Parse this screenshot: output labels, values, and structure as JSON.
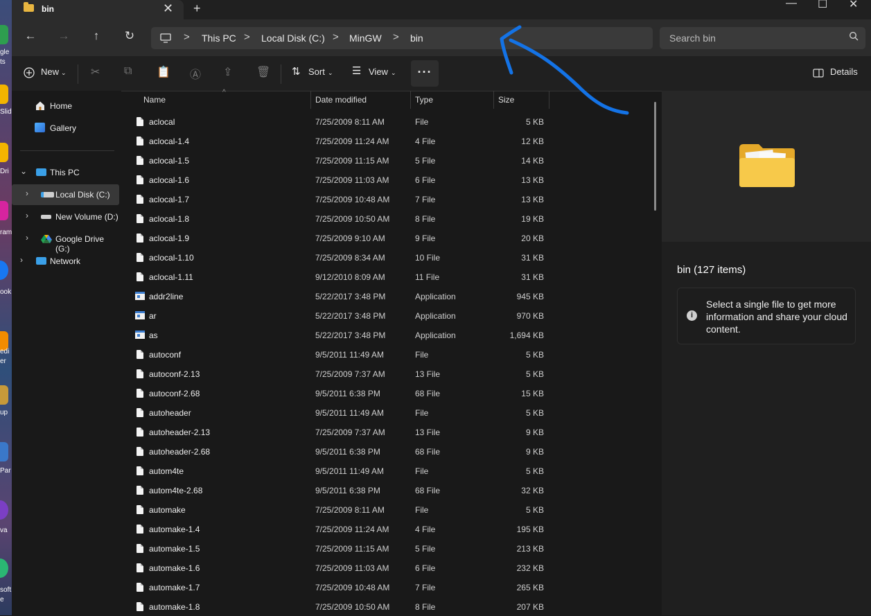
{
  "desktop": {
    "labels": [
      "gle",
      "ts",
      "Slid",
      "Dri",
      "ram",
      "ook",
      "edi",
      "er",
      "up",
      "Par",
      "va",
      "soft",
      "e"
    ]
  },
  "window": {
    "tab_title": "bin",
    "tab_close": "✕",
    "new_tab": "+",
    "minimize": "—",
    "maximize": "☐",
    "close": "✕"
  },
  "nav_buttons": {
    "back": "←",
    "forward": "→",
    "up": "↑",
    "refresh": "↻"
  },
  "breadcrumb": {
    "computer_icon": "monitor-icon",
    "items": [
      "This PC",
      "Local Disk (C:)",
      "MinGW",
      "bin"
    ],
    "separator": ">"
  },
  "search": {
    "placeholder": "Search bin",
    "icon": "search-icon"
  },
  "toolbar": {
    "new_label": "New",
    "sort_label": "Sort",
    "view_label": "View",
    "more_label": "···",
    "details_label": "Details",
    "icons": [
      "cut-icon",
      "copy-icon",
      "paste-icon",
      "rename-icon",
      "share-icon",
      "delete-icon"
    ]
  },
  "sidebar": {
    "home": "Home",
    "gallery": "Gallery",
    "this_pc": "This PC",
    "local_disk": "Local Disk (C:)",
    "new_volume": "New Volume (D:)",
    "google_drive": "Google Drive (G:)",
    "network": "Network"
  },
  "columns": {
    "name": "Name",
    "date": "Date modified",
    "type": "Type",
    "size": "Size"
  },
  "files": [
    {
      "name": "aclocal",
      "date": "7/25/2009 8:11 AM",
      "type": "File",
      "size": "5 KB",
      "kind": "file"
    },
    {
      "name": "aclocal-1.4",
      "date": "7/25/2009 11:24 AM",
      "type": "4 File",
      "size": "12 KB",
      "kind": "file"
    },
    {
      "name": "aclocal-1.5",
      "date": "7/25/2009 11:15 AM",
      "type": "5 File",
      "size": "14 KB",
      "kind": "file"
    },
    {
      "name": "aclocal-1.6",
      "date": "7/25/2009 11:03 AM",
      "type": "6 File",
      "size": "13 KB",
      "kind": "file"
    },
    {
      "name": "aclocal-1.7",
      "date": "7/25/2009 10:48 AM",
      "type": "7 File",
      "size": "13 KB",
      "kind": "file"
    },
    {
      "name": "aclocal-1.8",
      "date": "7/25/2009 10:50 AM",
      "type": "8 File",
      "size": "19 KB",
      "kind": "file"
    },
    {
      "name": "aclocal-1.9",
      "date": "7/25/2009 9:10 AM",
      "type": "9 File",
      "size": "20 KB",
      "kind": "file"
    },
    {
      "name": "aclocal-1.10",
      "date": "7/25/2009 8:34 AM",
      "type": "10 File",
      "size": "31 KB",
      "kind": "file"
    },
    {
      "name": "aclocal-1.11",
      "date": "9/12/2010 8:09 AM",
      "type": "11 File",
      "size": "31 KB",
      "kind": "file"
    },
    {
      "name": "addr2line",
      "date": "5/22/2017 3:48 PM",
      "type": "Application",
      "size": "945 KB",
      "kind": "app"
    },
    {
      "name": "ar",
      "date": "5/22/2017 3:48 PM",
      "type": "Application",
      "size": "970 KB",
      "kind": "app"
    },
    {
      "name": "as",
      "date": "5/22/2017 3:48 PM",
      "type": "Application",
      "size": "1,694 KB",
      "kind": "app"
    },
    {
      "name": "autoconf",
      "date": "9/5/2011 11:49 AM",
      "type": "File",
      "size": "5 KB",
      "kind": "file"
    },
    {
      "name": "autoconf-2.13",
      "date": "7/25/2009 7:37 AM",
      "type": "13 File",
      "size": "5 KB",
      "kind": "file"
    },
    {
      "name": "autoconf-2.68",
      "date": "9/5/2011 6:38 PM",
      "type": "68 File",
      "size": "15 KB",
      "kind": "file"
    },
    {
      "name": "autoheader",
      "date": "9/5/2011 11:49 AM",
      "type": "File",
      "size": "5 KB",
      "kind": "file"
    },
    {
      "name": "autoheader-2.13",
      "date": "7/25/2009 7:37 AM",
      "type": "13 File",
      "size": "9 KB",
      "kind": "file"
    },
    {
      "name": "autoheader-2.68",
      "date": "9/5/2011 6:38 PM",
      "type": "68 File",
      "size": "9 KB",
      "kind": "file"
    },
    {
      "name": "autom4te",
      "date": "9/5/2011 11:49 AM",
      "type": "File",
      "size": "5 KB",
      "kind": "file"
    },
    {
      "name": "autom4te-2.68",
      "date": "9/5/2011 6:38 PM",
      "type": "68 File",
      "size": "32 KB",
      "kind": "file"
    },
    {
      "name": "automake",
      "date": "7/25/2009 8:11 AM",
      "type": "File",
      "size": "5 KB",
      "kind": "file"
    },
    {
      "name": "automake-1.4",
      "date": "7/25/2009 11:24 AM",
      "type": "4 File",
      "size": "195 KB",
      "kind": "file"
    },
    {
      "name": "automake-1.5",
      "date": "7/25/2009 11:15 AM",
      "type": "5 File",
      "size": "213 KB",
      "kind": "file"
    },
    {
      "name": "automake-1.6",
      "date": "7/25/2009 11:03 AM",
      "type": "6 File",
      "size": "232 KB",
      "kind": "file"
    },
    {
      "name": "automake-1.7",
      "date": "7/25/2009 10:48 AM",
      "type": "7 File",
      "size": "265 KB",
      "kind": "file"
    },
    {
      "name": "automake-1.8",
      "date": "7/25/2009 10:50 AM",
      "type": "8 File",
      "size": "207 KB",
      "kind": "file"
    }
  ],
  "details_pane": {
    "title": "bin (127 items)",
    "message": "Select a single file to get more information and share your cloud content.",
    "info_icon": "i"
  },
  "colors": {
    "background": "#191919",
    "toolbar": "#202020",
    "address_bar": "#3a3a3a",
    "folder": "#e9b640",
    "annotation_arrow": "#1a73e8"
  }
}
